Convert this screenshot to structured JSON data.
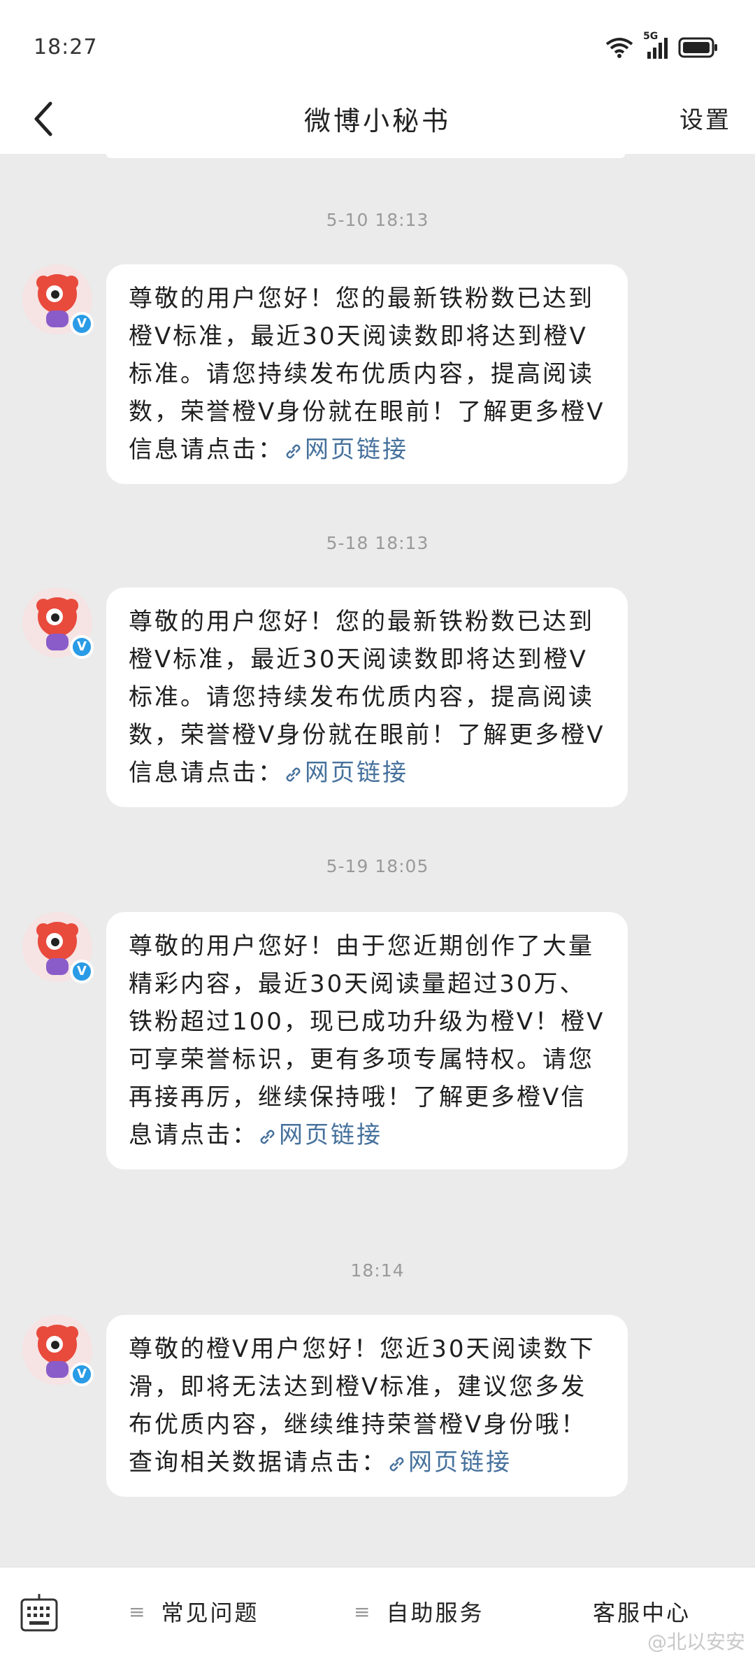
{
  "status_bar": {
    "time": "18:27",
    "network": "5G"
  },
  "nav": {
    "title": "微博小秘书",
    "settings_label": "设置"
  },
  "link_label": "网页链接",
  "messages": [
    {
      "timestamp": "5-10 18:13",
      "text": "尊敬的用户您好！您的最新铁粉数已达到橙V标准，最近30天阅读数即将达到橙V标准。请您持续发布优质内容，提高阅读数，荣誉橙V身份就在眼前！了解更多橙V信息请点击：",
      "link": "网页链接"
    },
    {
      "timestamp": "5-18 18:13",
      "text": "尊敬的用户您好！您的最新铁粉数已达到橙V标准，最近30天阅读数即将达到橙V标准。请您持续发布优质内容，提高阅读数，荣誉橙V身份就在眼前！了解更多橙V信息请点击：",
      "link": "网页链接"
    },
    {
      "timestamp": "5-19 18:05",
      "text": "尊敬的用户您好！由于您近期创作了大量精彩内容，最近30天阅读量超过30万、铁粉超过100，现已成功升级为橙V！橙V可享荣誉标识，更有多项专属特权。请您再接再厉，继续保持哦！了解更多橙V信息请点击：",
      "link": "网页链接"
    },
    {
      "timestamp": "18:14",
      "text": "尊敬的橙V用户您好！您近30天阅读数下滑，即将无法达到橙V标准，建议您多发布优质内容，继续维持荣誉橙V身份哦！查询相关数据请点击：",
      "link": "网页链接"
    }
  ],
  "avatar_badge": "V",
  "bottom_bar": {
    "menu_1": "常见问题",
    "menu_2": "自助服务",
    "menu_3": "客服中心",
    "menu_icon": "≡"
  },
  "watermark": "@北以安安",
  "colors": {
    "link": "#46719c",
    "badge": "#2a9be6",
    "avatar": "#e84a3c"
  }
}
